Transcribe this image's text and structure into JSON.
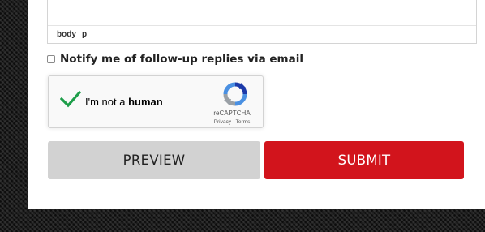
{
  "editor": {
    "path": [
      "body",
      "p"
    ]
  },
  "notify": {
    "label": "Notify me of follow-up replies via email",
    "checked": false
  },
  "captcha": {
    "label_prefix": "I'm not a ",
    "label_emphasis": "human",
    "brand": "reCAPTCHA",
    "links": "Privacy - Terms",
    "verified": true
  },
  "buttons": {
    "preview_label": "PREVIEW",
    "submit_label": "SUBMIT"
  },
  "colors": {
    "submit_bg": "#d2141c",
    "preview_bg": "#d2d2d2",
    "check_green": "#1e9e4a"
  },
  "icons": {
    "check": "checkmark-icon",
    "recaptcha": "recaptcha-logo-icon"
  }
}
